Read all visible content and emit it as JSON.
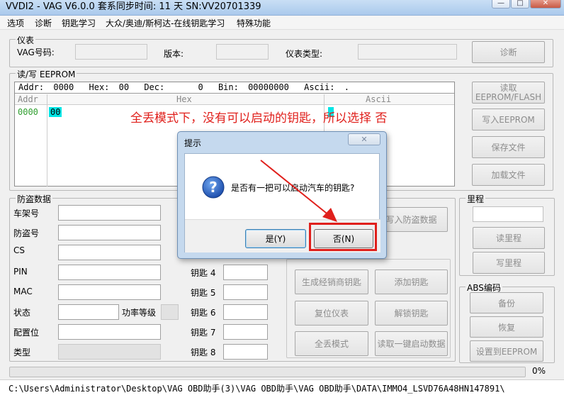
{
  "window": {
    "title": "VVDI2 - VAG V6.0.0   套系同步时间: 11 天    SN:VV20701339",
    "min": "—",
    "max": "□",
    "close": "✕"
  },
  "menu": [
    "选项",
    "诊断",
    "钥匙学习",
    "大众/奥迪/斯柯达-在线钥匙学习",
    "特殊功能"
  ],
  "instrument": {
    "legend": "仪表",
    "vag_label": "VAG号码:",
    "version_label": "版本:",
    "type_label": "仪表类型:",
    "diag_button": "诊断"
  },
  "eeprom": {
    "legend": "读/写 EEPROM",
    "info": {
      "addr_label": "Addr:",
      "addr": "0000",
      "hex_label": "Hex:",
      "hex": "00",
      "dec_label": "Dec:",
      "dec": "0",
      "bin_label": "Bin:",
      "bin": "00000000",
      "ascii_label": "Ascii:",
      "ascii": "."
    },
    "headers": {
      "addr": "Addr",
      "hex": "Hex",
      "ascii": "Ascii"
    },
    "row_addr": "0000",
    "row_hex": "00",
    "buttons": {
      "read": "读取\nEEPROM/FLASH",
      "write": "写入EEPROM",
      "save": "保存文件",
      "load": "加载文件"
    }
  },
  "annotation": "全丢模式下，没有可以启动的钥匙，所以选择 否",
  "immo": {
    "legend": "防盗数据",
    "labels": {
      "vin": "车架号",
      "immo": "防盗号",
      "cs": "CS",
      "pin": "PIN",
      "mac": "MAC",
      "status": "状态",
      "power": "功率等级",
      "config": "配置位",
      "type": "类型"
    },
    "keys": [
      "钥匙 4",
      "钥匙 5",
      "钥匙 6",
      "钥匙 7",
      "钥匙 8"
    ]
  },
  "actions": {
    "write_immo": "写入防盗数据",
    "gen_dealer_key": "生成经销商钥匙",
    "add_key": "添加钥匙",
    "reset_cluster": "复位仪表",
    "unlock_key": "解锁钥匙",
    "all_lost": "全丢模式",
    "read_one_key": "读取一键启动数据"
  },
  "mileage": {
    "legend": "里程",
    "read": "读里程",
    "write": "写里程"
  },
  "abs": {
    "legend": "ABS编码",
    "backup": "备份",
    "restore": "恢复",
    "set_eeprom": "设置到EEPROM"
  },
  "progress": {
    "percent": "0%",
    "value": 0
  },
  "status_path": "C:\\Users\\Administrator\\Desktop\\VAG OBD助手(3)\\VAG OBD助手\\VAG OBD助手\\DATA\\IMMO4_LSVD76A48HN147891\\",
  "dialog": {
    "title": "提示",
    "close": "✕",
    "icon": "question-icon",
    "message": "是否有一把可以启动汽车的钥匙?",
    "yes": "是(Y)",
    "no": "否(N)"
  },
  "colors": {
    "highlight": "#e0201c",
    "cyan": "#00e5e5",
    "addr_green": "#2e9e2e"
  }
}
